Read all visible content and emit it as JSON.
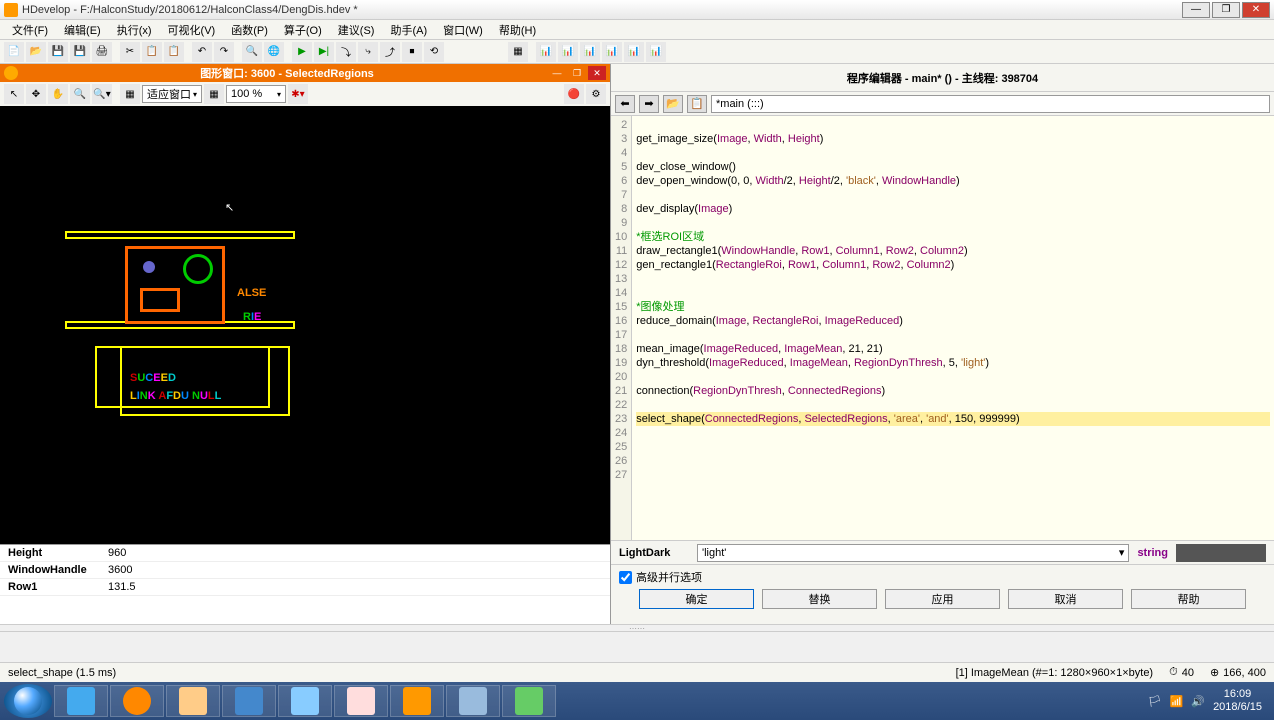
{
  "titlebar": {
    "title": "HDevelop - F:/HalconStudy/20180612/HalconClass4/DengDis.hdev *"
  },
  "menus": [
    "文件(F)",
    "编辑(E)",
    "执行(x)",
    "可视化(V)",
    "函数(P)",
    "算子(O)",
    "建议(S)",
    "助手(A)",
    "窗口(W)",
    "帮助(H)"
  ],
  "graphics_window": {
    "title": "图形窗口: 3600 - SelectedRegions",
    "fit_label": "适应窗口",
    "zoom_label": "100 %"
  },
  "editor": {
    "title": "程序编辑器 - main* () - 主线程: 398704",
    "current_proc": "*main (:::)"
  },
  "code_lines": [
    {
      "n": 2,
      "t": ""
    },
    {
      "n": 3,
      "t": "get_image_size(Image, Width, Height)"
    },
    {
      "n": 4,
      "t": ""
    },
    {
      "n": 5,
      "t": "dev_close_window()"
    },
    {
      "n": 6,
      "t": "dev_open_window(0, 0, Width/2, Height/2, 'black', WindowHandle)"
    },
    {
      "n": 7,
      "t": ""
    },
    {
      "n": 8,
      "t": "dev_display(Image)"
    },
    {
      "n": 9,
      "t": ""
    },
    {
      "n": 10,
      "t": "*框选ROI区域",
      "comment": true
    },
    {
      "n": 11,
      "t": "draw_rectangle1(WindowHandle, Row1, Column1, Row2, Column2)"
    },
    {
      "n": 12,
      "t": "gen_rectangle1(RectangleRoi, Row1, Column1, Row2, Column2)"
    },
    {
      "n": 13,
      "t": ""
    },
    {
      "n": 14,
      "t": ""
    },
    {
      "n": 15,
      "t": "*图像处理",
      "comment": true
    },
    {
      "n": 16,
      "t": "reduce_domain(Image, RectangleRoi, ImageReduced)"
    },
    {
      "n": 17,
      "t": ""
    },
    {
      "n": 18,
      "t": "mean_image(ImageReduced, ImageMean, 21, 21)"
    },
    {
      "n": 19,
      "t": "dyn_threshold(ImageReduced, ImageMean, RegionDynThresh, 5, 'light')"
    },
    {
      "n": 20,
      "t": ""
    },
    {
      "n": 21,
      "t": "connection(RegionDynThresh, ConnectedRegions)"
    },
    {
      "n": 22,
      "t": ""
    },
    {
      "n": 23,
      "t": "select_shape(ConnectedRegions, SelectedRegions, 'area', 'and', 150, 999999)",
      "current": true
    },
    {
      "n": 24,
      "t": ""
    },
    {
      "n": 25,
      "t": ""
    },
    {
      "n": 26,
      "t": ""
    },
    {
      "n": 27,
      "t": ""
    }
  ],
  "vars": [
    {
      "name": "Height",
      "value": "960"
    },
    {
      "name": "WindowHandle",
      "value": "3600"
    },
    {
      "name": "Row1",
      "value": "131.5"
    }
  ],
  "param": {
    "label": "LightDark",
    "value": "'light'",
    "type": "string"
  },
  "dialog": {
    "check_label": "高级并行选项",
    "buttons": [
      "确定",
      "替换",
      "应用",
      "取消",
      "帮助"
    ]
  },
  "status": {
    "left": "select_shape (1.5 ms)",
    "center": "[1] ImageMean (#=1: 1280×960×1×byte)",
    "ms": "40",
    "coords": "166, 400"
  },
  "clock": {
    "time": "16:09",
    "date": "2018/6/15"
  },
  "canvas_texts": {
    "t1": "ALSE",
    "t2": "RIE",
    "t3": "SUCEED",
    "t4": "LINK AFDU NULL"
  }
}
